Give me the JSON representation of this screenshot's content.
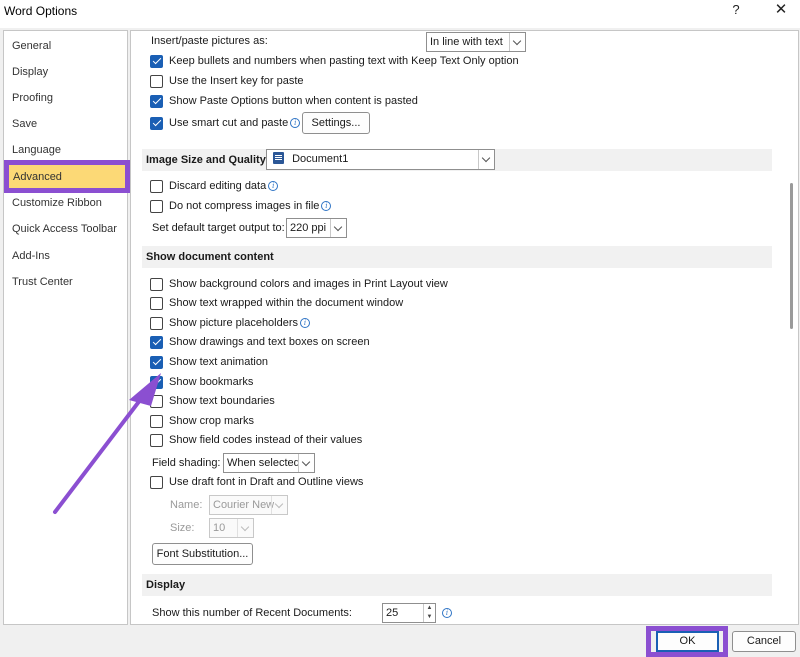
{
  "window": {
    "title": "Word Options",
    "help_glyph": "?",
    "close_glyph": "✕"
  },
  "sidebar": {
    "items": [
      {
        "label": "General"
      },
      {
        "label": "Display"
      },
      {
        "label": "Proofing"
      },
      {
        "label": "Save"
      },
      {
        "label": "Language"
      },
      {
        "label": "Advanced",
        "selected": true
      },
      {
        "label": "Customize Ribbon"
      },
      {
        "label": "Quick Access Toolbar"
      },
      {
        "label": "Add-Ins"
      },
      {
        "label": "Trust Center"
      }
    ]
  },
  "cut_copy_paste": {
    "insert_paste_label": "Insert/paste pictures as:",
    "insert_paste_value": "In line with text",
    "keep_bullets": {
      "label": "Keep bullets and numbers when pasting text with Keep Text Only option",
      "checked": true
    },
    "use_insert_key": {
      "label": "Use the Insert key for paste",
      "checked": false
    },
    "show_paste_options": {
      "label": "Show Paste Options button when content is pasted",
      "checked": true
    },
    "smart_cut": {
      "label": "Use smart cut and paste",
      "checked": true
    },
    "settings_button": "Settings..."
  },
  "image_size": {
    "section_title": "Image Size and Quality",
    "document": "Document1",
    "discard_editing": {
      "label": "Discard editing data",
      "checked": false
    },
    "do_not_compress": {
      "label": "Do not compress images in file",
      "checked": false
    },
    "target_output_label": "Set default target output to:",
    "target_output_value": "220 ppi"
  },
  "show_document_content": {
    "section_title": "Show document content",
    "options": [
      {
        "label": "Show background colors and images in Print Layout view",
        "checked": false,
        "info": false
      },
      {
        "label": "Show text wrapped within the document window",
        "checked": false,
        "info": false
      },
      {
        "label": "Show picture placeholders",
        "checked": false,
        "info": true
      },
      {
        "label": "Show drawings and text boxes on screen",
        "checked": true,
        "info": false
      },
      {
        "label": "Show text animation",
        "checked": true,
        "info": false
      },
      {
        "label": "Show bookmarks",
        "checked": true,
        "info": false
      },
      {
        "label": "Show text boundaries",
        "checked": false,
        "info": false
      },
      {
        "label": "Show crop marks",
        "checked": false,
        "info": false
      },
      {
        "label": "Show field codes instead of their values",
        "checked": false,
        "info": false
      }
    ],
    "field_shading_label": "Field shading:",
    "field_shading_value": "When selected",
    "use_draft_font": {
      "label": "Use draft font in Draft and Outline views",
      "checked": false
    },
    "name_label": "Name:",
    "name_value": "Courier New",
    "size_label": "Size:",
    "size_value": "10",
    "font_substitution_button": "Font Substitution..."
  },
  "display": {
    "section_title": "Display",
    "recent_docs_label": "Show this number of Recent Documents:",
    "recent_docs_value": "25"
  },
  "footer": {
    "ok": "OK",
    "cancel": "Cancel"
  },
  "colors": {
    "highlight": "#8b4fd1",
    "selected_nav": "#fcd976",
    "checkbox_blue": "#1a5fb4"
  }
}
